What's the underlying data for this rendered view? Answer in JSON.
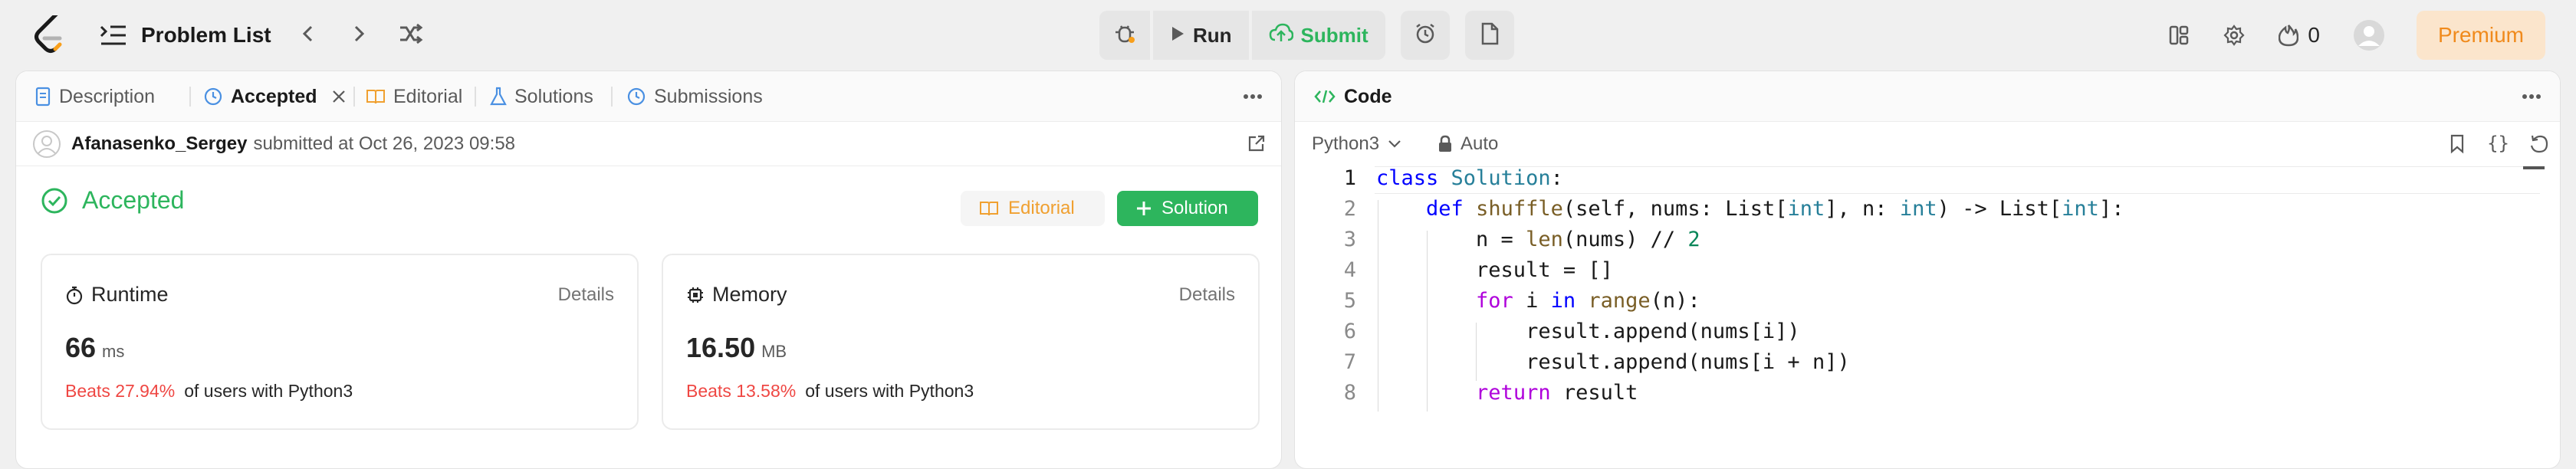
{
  "topbar": {
    "title": "Problem List",
    "run_label": "Run",
    "submit_label": "Submit",
    "streak_count": "0",
    "premium_label": "Premium"
  },
  "left_tabs": [
    {
      "label": "Description"
    },
    {
      "label": "Accepted"
    },
    {
      "label": "Editorial"
    },
    {
      "label": "Solutions"
    },
    {
      "label": "Submissions"
    }
  ],
  "submission": {
    "username": "Afanasenko_Sergey",
    "submitted_text": "submitted at Oct 26, 2023 09:58",
    "status": "Accepted",
    "editorial_label": "Editorial",
    "solution_label": "Solution"
  },
  "runtime": {
    "title": "Runtime",
    "details": "Details",
    "value": "66",
    "unit": "ms",
    "beats_pct": "Beats 27.94%",
    "beats_text": "of users with Python3"
  },
  "memory": {
    "title": "Memory",
    "details": "Details",
    "value": "16.50",
    "unit": "MB",
    "beats_pct": "Beats 13.58%",
    "beats_text": "of users with Python3"
  },
  "code_panel": {
    "tab_label": "Code",
    "language": "Python3",
    "mode": "Auto",
    "line_numbers": [
      "1",
      "2",
      "3",
      "4",
      "5",
      "6",
      "7",
      "8"
    ]
  },
  "colors": {
    "accent_green": "#2db55d",
    "beats_red": "#ef4743",
    "premium_orange": "#f08a1c"
  }
}
